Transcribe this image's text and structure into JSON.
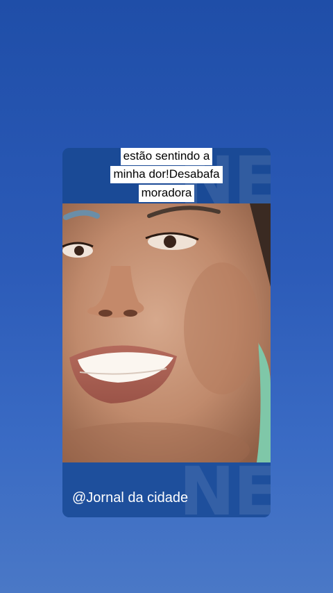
{
  "post": {
    "caption_lines": [
      "estão sentindo a",
      "minha dor!Desabafa",
      "moradora"
    ],
    "credit": "@Jornal da cidade",
    "watermark_text": "NE"
  },
  "colors": {
    "background_top": "#1f4ea8",
    "background_bottom": "#4a78c6",
    "card_band": "#1a4a96",
    "caption_bg": "#ffffff",
    "caption_text": "#000000",
    "credit_text": "#ffffff"
  }
}
